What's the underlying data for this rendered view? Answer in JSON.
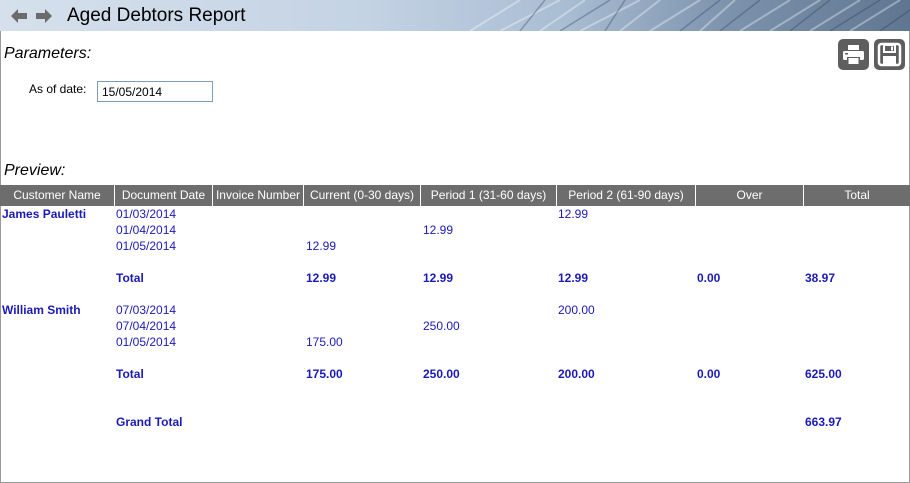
{
  "window": {
    "title": "Aged Debtors Report"
  },
  "parameters": {
    "section_title": "Parameters:",
    "as_of_label": "As of date:",
    "as_of_value": "15/05/2014"
  },
  "toolbar": {
    "print_icon": "printer-icon",
    "save_icon": "floppy-disk-icon"
  },
  "preview": {
    "section_title": "Preview:",
    "columns": [
      "Customer Name",
      "Document Date",
      "Invoice Number",
      "Current (0-30 days)",
      "Period 1 (31-60 days)",
      "Period 2 (61-90 days)",
      "Over",
      "Total"
    ],
    "customers": [
      {
        "name": "James Pauletti",
        "rows": [
          {
            "date": "01/03/2014",
            "invoice": "",
            "current": "",
            "period1": "",
            "period2": "12.99"
          },
          {
            "date": "01/04/2014",
            "invoice": "",
            "current": "",
            "period1": "12.99",
            "period2": ""
          },
          {
            "date": "01/05/2014",
            "invoice": "",
            "current": "12.99",
            "period1": "",
            "period2": ""
          }
        ],
        "total": {
          "label": "Total",
          "current": "12.99",
          "period1": "12.99",
          "period2": "12.99",
          "over": "0.00",
          "total": "38.97"
        }
      },
      {
        "name": "William Smith",
        "rows": [
          {
            "date": "07/03/2014",
            "invoice": "",
            "current": "",
            "period1": "",
            "period2": "200.00"
          },
          {
            "date": "07/04/2014",
            "invoice": "",
            "current": "",
            "period1": "250.00",
            "period2": ""
          },
          {
            "date": "01/05/2014",
            "invoice": "",
            "current": "175.00",
            "period1": "",
            "period2": ""
          }
        ],
        "total": {
          "label": "Total",
          "current": "175.00",
          "period1": "250.00",
          "period2": "200.00",
          "over": "0.00",
          "total": "625.00"
        }
      }
    ],
    "grand_total": {
      "label": "Grand Total",
      "total": "663.97"
    }
  },
  "colors": {
    "header_bg": "#6d6d6d",
    "link_text": "#1a1ab8",
    "toolbar_button": "#5e5e5e"
  }
}
